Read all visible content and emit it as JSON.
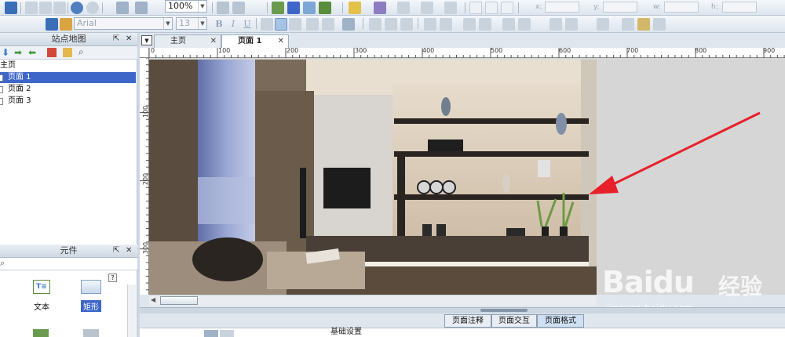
{
  "toolbar": {
    "zoom": "100%",
    "font_family": "Arial",
    "font_size": "13",
    "bold": "B",
    "italic": "I",
    "underline": "U",
    "coord_x": "x:",
    "coord_y": "y:",
    "coord_w": "w:",
    "coord_h": "h:"
  },
  "sitemap": {
    "title": "站点地图",
    "root": "主页",
    "pages": [
      "页面 1",
      "页面 2",
      "页面 3"
    ],
    "selected_index": 0
  },
  "widgets_panel": {
    "title": "元件",
    "help": "?",
    "items": [
      "文本",
      "矩形"
    ]
  },
  "tabs": [
    {
      "label": "主页",
      "active": false
    },
    {
      "label": "页面 1",
      "active": true
    }
  ],
  "ruler": {
    "h_labels": [
      "0",
      "100",
      "200",
      "300",
      "400",
      "500",
      "600",
      "700",
      "800",
      "900"
    ],
    "v_labels": [
      "100",
      "200",
      "300"
    ]
  },
  "bottom_tabs": [
    {
      "label": "页面注释",
      "active": false
    },
    {
      "label": "页面交互",
      "active": false
    },
    {
      "label": "页面格式",
      "active": true
    }
  ],
  "bottom_panel": {
    "partial_label": "基础设置"
  },
  "watermark": {
    "brand": "Baidu",
    "cn": "经验",
    "url": "jingyan.baidu.com"
  },
  "colors": {
    "selection": "#3d66c8",
    "arrow": "#e8202a",
    "toolbar": "#dde5ee"
  }
}
